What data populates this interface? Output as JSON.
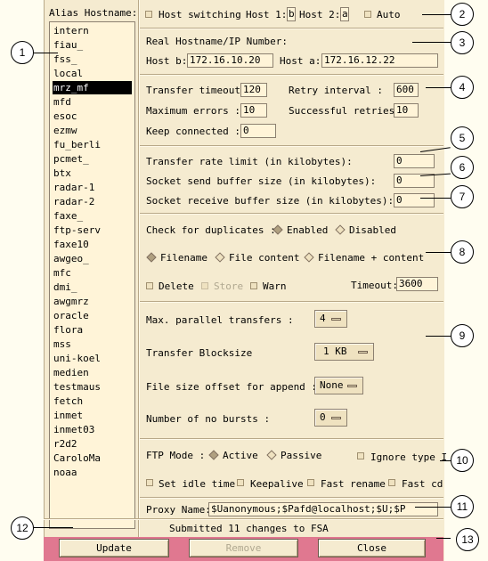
{
  "alias": {
    "label": "Alias Hostname:",
    "items": [
      "intern",
      "fiau_",
      "fss_",
      "local",
      "mrz_mf",
      "mfd",
      "esoc",
      "ezmw",
      "fu_berli",
      "pcmet_",
      "btx",
      "radar-1",
      "radar-2",
      "faxe_",
      "ftp-serv",
      "faxe10",
      "awgeo_",
      "mfc",
      "dmi_",
      "awgmrz",
      "oracle",
      "flora",
      "mss",
      "uni-koel",
      "medien",
      "testmaus",
      "fetch",
      "inmet",
      "inmet03",
      "r2d2",
      "CaroloMa",
      "noaa"
    ],
    "selected": "mrz_mf"
  },
  "host_switch": {
    "label": "Host switching",
    "host1_label": "Host 1:",
    "host1_value": "b",
    "host2_label": "Host 2:",
    "host2_value": "a",
    "auto_label": "Auto"
  },
  "real_host": {
    "title": "Real Hostname/IP Number:",
    "host_b_label": "Host b:",
    "host_b_value": "172.16.10.20",
    "host_a_label": "Host a:",
    "host_a_value": "172.16.12.22"
  },
  "timeouts": {
    "transfer_timeout_label": "Transfer timeout:",
    "transfer_timeout": "120",
    "retry_interval_label": "Retry interval    :",
    "retry_interval": "600",
    "max_errors_label": "Maximum errors   :",
    "max_errors": "10",
    "successful_retries_label": "Successful retries:",
    "successful_retries": "10",
    "keep_connected_label": "Keep connected   :",
    "keep_connected": "0"
  },
  "buffers": {
    "rate_limit_label": "Transfer rate limit (in kilobytes):",
    "rate_limit": "0",
    "send_buffer_label": "Socket send buffer size (in kilobytes):",
    "send_buffer": "0",
    "recv_buffer_label": "Socket receive buffer size (in kilobytes):",
    "recv_buffer": "0"
  },
  "duplicates": {
    "label": "Check for duplicates :",
    "enabled_label": "Enabled",
    "disabled_label": "Disabled",
    "filename_label": "Filename",
    "file_content_label": "File content",
    "filename_content_label": "Filename + content",
    "delete_label": "Delete",
    "store_label": "Store",
    "warn_label": "Warn",
    "timeout_label": "Timeout:",
    "timeout_value": "3600"
  },
  "transfer": {
    "parallel_label": "Max. parallel transfers      :",
    "parallel_value": "4",
    "blocksize_label": "Transfer Blocksize",
    "blocksize_value": "1 KB",
    "offset_label": "File size offset for append  :",
    "offset_value": "None",
    "bursts_label": "Number of no bursts          :",
    "bursts_value": "0"
  },
  "ftp": {
    "mode_label": "FTP Mode :",
    "active_label": "Active",
    "passive_label": "Passive",
    "ignore_type_label": "Ignore type I",
    "idle_label": "Set idle time",
    "keepalive_label": "Keepalive",
    "fast_rename_label": "Fast rename",
    "fast_cd_label": "Fast cd"
  },
  "proxy": {
    "label": "Proxy Name:",
    "value": "$Uanonymous;$Pafd@localhost;$U;$P"
  },
  "status": "Submitted 11 changes to FSA",
  "buttons": {
    "update": "Update",
    "remove": "Remove",
    "close": "Close"
  },
  "callouts": [
    "1",
    "2",
    "3",
    "4",
    "5",
    "6",
    "7",
    "8",
    "9",
    "10",
    "11",
    "12",
    "13"
  ],
  "colors": {
    "panel": "#f5ebd0",
    "field": "#fff4d8",
    "button_bar": "#e07890",
    "selected_bg": "#000000"
  }
}
